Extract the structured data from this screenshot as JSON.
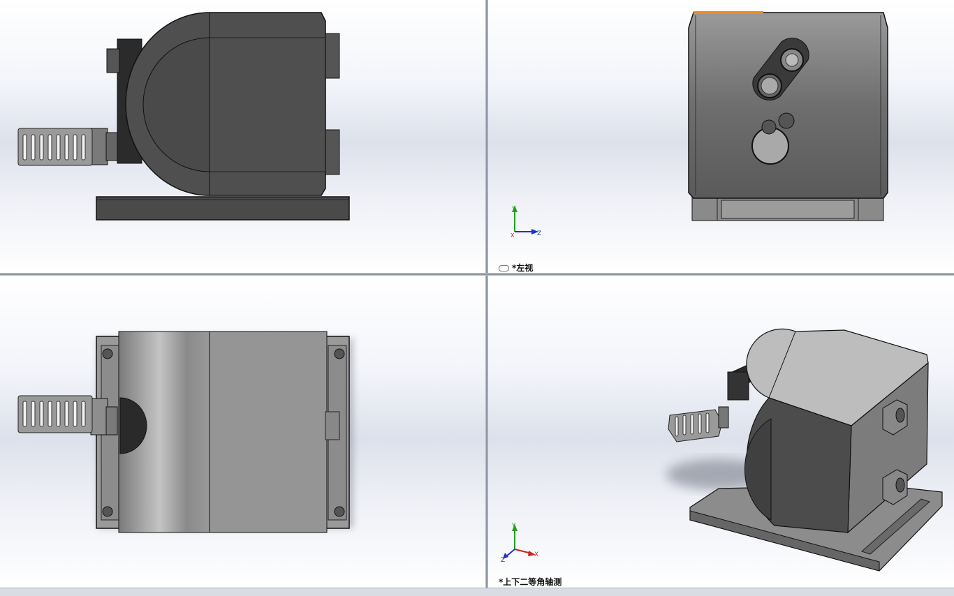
{
  "viewports": {
    "front": {
      "label": ""
    },
    "left": {
      "label": "*左视"
    },
    "top": {
      "label": ""
    },
    "iso": {
      "label": "*上下二等角轴测"
    }
  },
  "triad": {
    "x": "X",
    "y": "Y",
    "z": "Z"
  },
  "colors": {
    "body_dark": "#4d4d4d",
    "body_light": "#8f8f8f",
    "edge": "#1a1a1a",
    "axis_x": "#d02020",
    "axis_y": "#20a020",
    "axis_z": "#2030d0",
    "highlight": "#f08a24"
  }
}
